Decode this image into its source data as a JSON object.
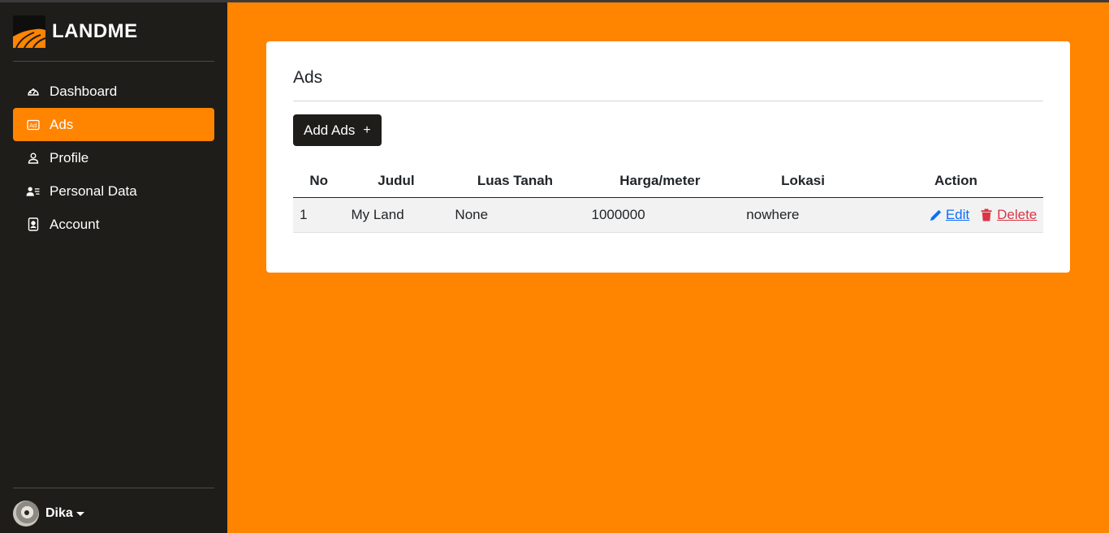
{
  "brand": {
    "name": "LANDME"
  },
  "sidebar": {
    "items": [
      {
        "label": "Dashboard",
        "icon": "speedometer-icon",
        "active": false
      },
      {
        "label": "Ads",
        "icon": "ad-icon",
        "active": true
      },
      {
        "label": "Profile",
        "icon": "person-icon",
        "active": false
      },
      {
        "label": "Personal Data",
        "icon": "person-lines-icon",
        "active": false
      },
      {
        "label": "Account",
        "icon": "person-badge-icon",
        "active": false
      }
    ],
    "user": {
      "name": "Dika"
    }
  },
  "colors": {
    "accent": "#ff8400",
    "sidebar_bg": "#1e1d1a",
    "edit_link": "#0d6efd",
    "delete_link": "#dc3545"
  },
  "main": {
    "title": "Ads",
    "add_button": {
      "label": "Add Ads",
      "icon_text": "+"
    },
    "table": {
      "headers": [
        "No",
        "Judul",
        "Luas Tanah",
        "Harga/meter",
        "Lokasi",
        "Action"
      ],
      "rows": [
        {
          "no": "1",
          "judul": "My Land",
          "luas_tanah": "None",
          "harga_meter": "1000000",
          "lokasi": "nowhere",
          "edit_label": "Edit",
          "delete_label": "Delete"
        }
      ]
    }
  }
}
